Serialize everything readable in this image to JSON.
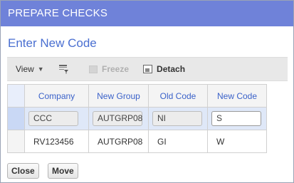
{
  "window": {
    "title": "PREPARE CHECKS"
  },
  "section": {
    "title": "Enter New Code"
  },
  "toolbar": {
    "view_label": "View",
    "freeze_label": "Freeze",
    "detach_label": "Detach"
  },
  "grid": {
    "columns": [
      "Company",
      "New Group",
      "Old Code",
      "New Code"
    ],
    "rows": [
      [
        "CCC",
        "AUTGRP08",
        "NI",
        "S"
      ],
      [
        "RV123456",
        "AUTGRP08",
        "GI",
        "W"
      ]
    ]
  },
  "footer": {
    "close_label": "Close",
    "move_label": "Move"
  },
  "colors": {
    "titlebar": "#6f82d9",
    "accent": "#4a6fd1"
  }
}
